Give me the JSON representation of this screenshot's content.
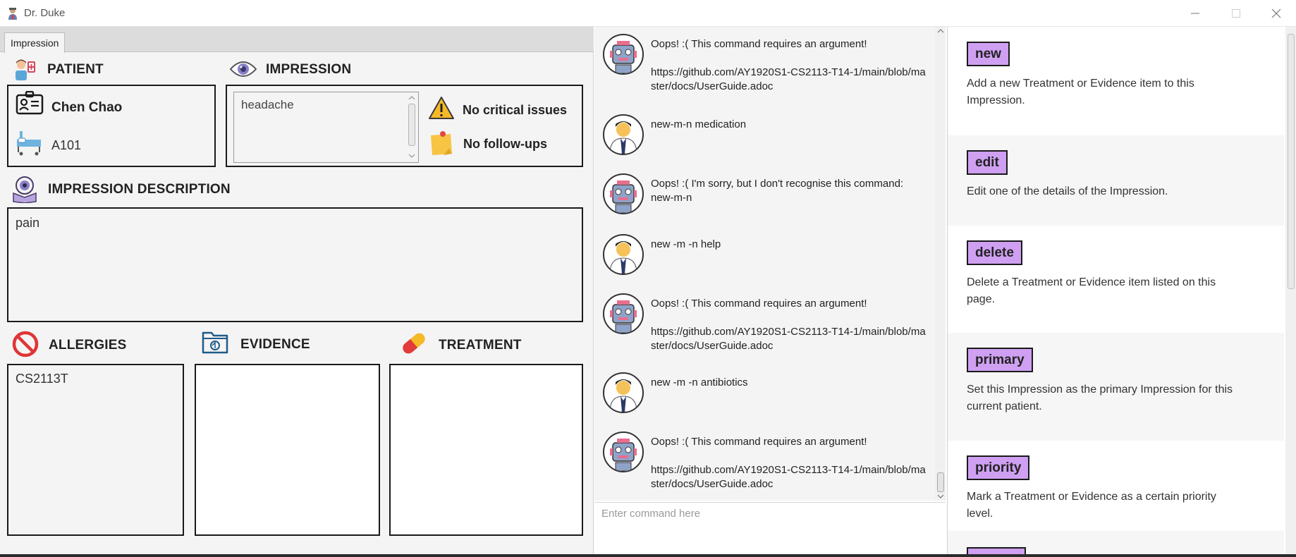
{
  "window": {
    "title": "Dr. Duke"
  },
  "tabs": [
    {
      "label": "Impression"
    }
  ],
  "patient": {
    "heading": "PATIENT",
    "name": "Chen Chao",
    "bed": "A101"
  },
  "impression": {
    "heading": "IMPRESSION",
    "name": "headache",
    "critical": "No critical issues",
    "followups": "No follow-ups"
  },
  "description": {
    "heading": "IMPRESSION DESCRIPTION",
    "text": "pain"
  },
  "allergies": {
    "heading": "ALLERGIES",
    "items": [
      "CS2113T"
    ]
  },
  "evidence": {
    "heading": "EVIDENCE"
  },
  "treatment": {
    "heading": "TREATMENT"
  },
  "chat": {
    "messages": [
      {
        "sender": "bot",
        "text": "Oops! :( This command requires an argument!\n\nhttps://github.com/AY1920S1-CS2113-T14-1/main/blob/master/docs/UserGuide.adoc"
      },
      {
        "sender": "user",
        "text": "new-m-n medication"
      },
      {
        "sender": "bot",
        "text": "Oops! :( I'm sorry, but I don't recognise this command: new-m-n"
      },
      {
        "sender": "user",
        "text": "new -m -n help"
      },
      {
        "sender": "bot",
        "text": "Oops! :( This command requires an argument!\n\nhttps://github.com/AY1920S1-CS2113-T14-1/main/blob/master/docs/UserGuide.adoc"
      },
      {
        "sender": "user",
        "text": "new -m -n antibiotics"
      },
      {
        "sender": "bot",
        "text": "Oops! :( This command requires an argument!\n\nhttps://github.com/AY1920S1-CS2113-T14-1/main/blob/master/docs/UserGuide.adoc"
      }
    ],
    "input_placeholder": "Enter command here"
  },
  "help": [
    {
      "command": "new",
      "description": "Add a new Treatment or Evidence item to this Impression."
    },
    {
      "command": "edit",
      "description": "Edit one of the details of the Impression."
    },
    {
      "command": "delete",
      "description": "Delete a Treatment or Evidence item listed on this page."
    },
    {
      "command": "primary",
      "description": "Set this Impression as the primary Impression for this current patient."
    },
    {
      "command": "priority",
      "description": "Mark a Treatment or Evidence as a certain priority level."
    }
  ],
  "colors": {
    "command_badge": "#cfa0f2",
    "panel_bg": "#f4f4f4",
    "border": "#1a1a1a"
  }
}
